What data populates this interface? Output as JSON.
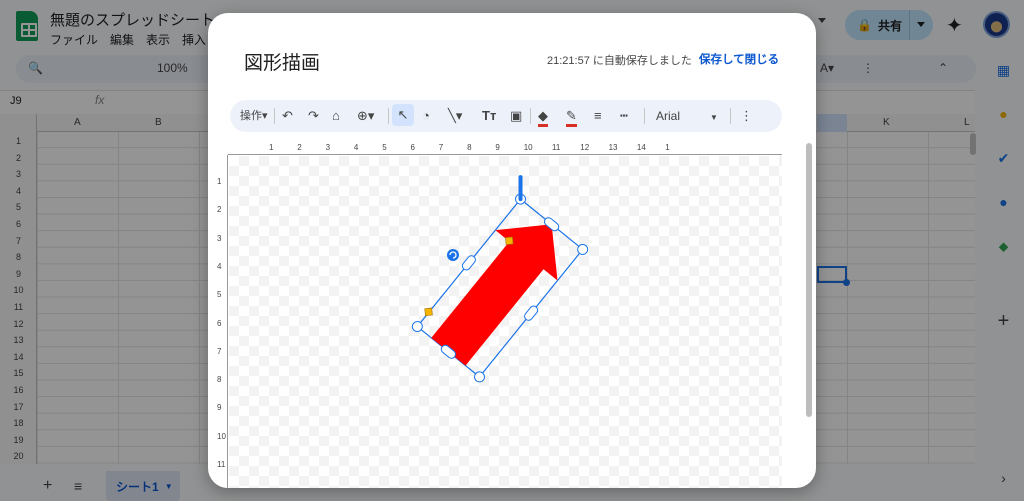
{
  "sheets": {
    "title": "無題のスプレッドシート",
    "menu": [
      "ファイル",
      "編集",
      "表示",
      "挿入"
    ],
    "share_label": "共有",
    "zoom": "100%",
    "cell_ref": "J9",
    "fx": "fx",
    "columns": [
      "A",
      "B",
      "K",
      "L"
    ],
    "rows": [
      "1",
      "2",
      "3",
      "4",
      "5",
      "6",
      "7",
      "8",
      "9",
      "10",
      "11",
      "12",
      "13",
      "14",
      "15",
      "16",
      "17",
      "18",
      "19",
      "20"
    ],
    "sheet_tab": "シート1"
  },
  "dialog": {
    "title": "図形描画",
    "autosave": "21:21:57 に自動保存しました",
    "save_close": "保存して閉じる",
    "toolbar": {
      "actions_label": "操作",
      "font": "Arial"
    },
    "ruler_h": [
      "1",
      "2",
      "3",
      "4",
      "5",
      "6",
      "7",
      "8",
      "9",
      "10",
      "11",
      "12",
      "13",
      "14",
      "1"
    ],
    "ruler_v": [
      "1",
      "2",
      "3",
      "4",
      "5",
      "6",
      "7",
      "8",
      "9",
      "10",
      "11"
    ]
  },
  "colors": {
    "arrow_fill": "#ff0000",
    "selection": "#1a73e8",
    "accent": "#0b57d0",
    "fill_underline": "#d93025"
  }
}
